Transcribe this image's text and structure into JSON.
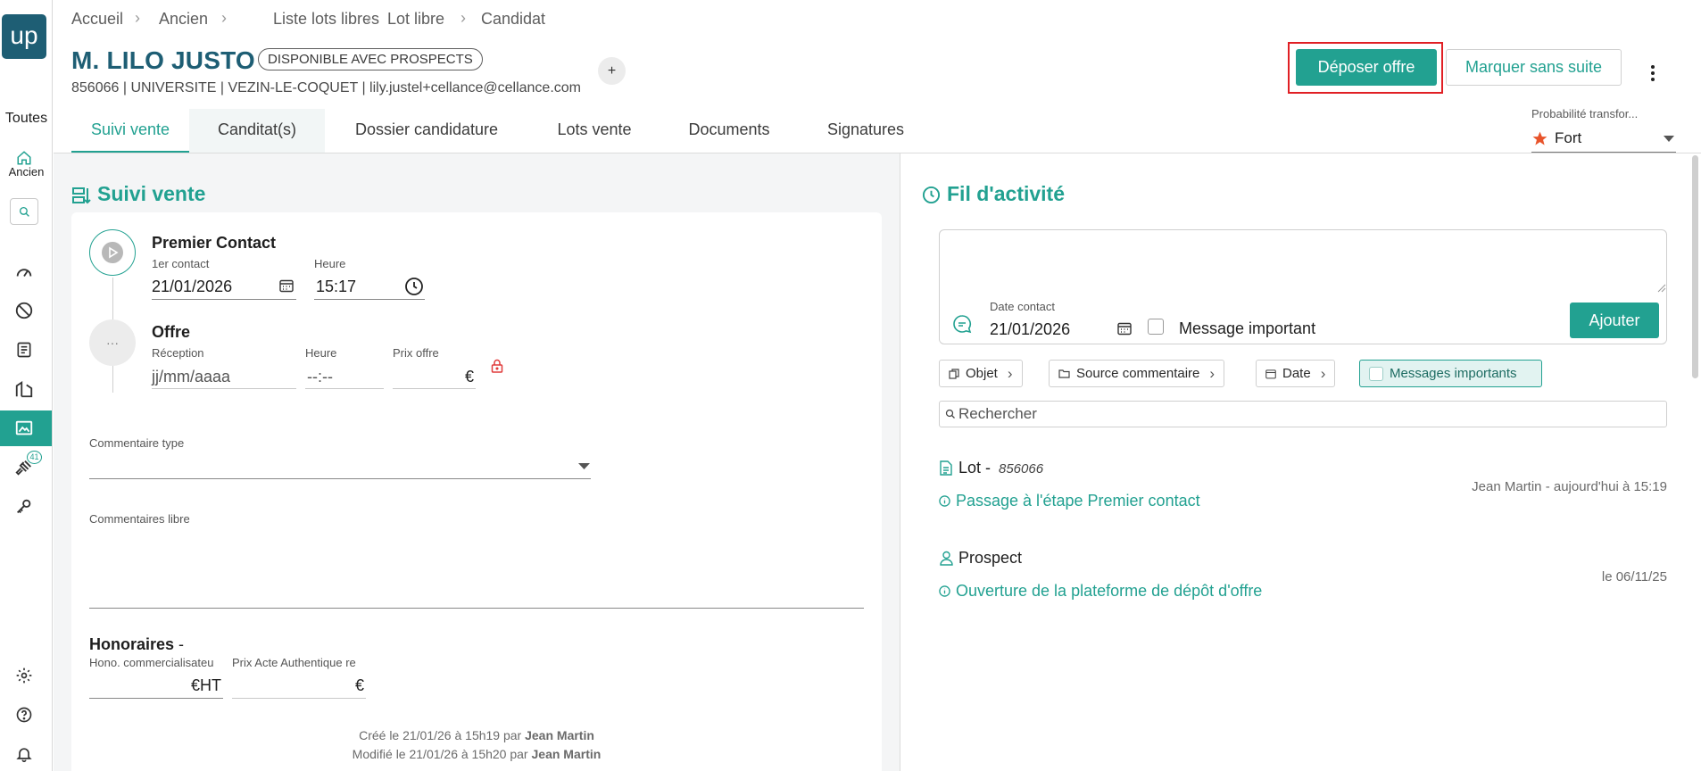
{
  "sidebar": {
    "logo": "up",
    "all_label": "Toutes",
    "home_label": "Ancien",
    "badge_count": "41"
  },
  "breadcrumb": [
    "Accueil",
    "Ancien",
    "Liste lots libres",
    "Lot libre",
    "Candidat"
  ],
  "header": {
    "name": "M. LILO JUSTO",
    "status": "DISPONIBLE AVEC PROSPECTS",
    "subline": "856066 | UNIVERSITE | VEZIN-LE-COQUET | lily.justel+cellance@cellance.com",
    "plus": "+",
    "primary_action": "Déposer offre",
    "secondary_action": "Marquer sans suite"
  },
  "tabs": [
    "Suivi vente",
    "Canditat(s)",
    "Dossier candidature",
    "Lots vente",
    "Documents",
    "Signatures"
  ],
  "probability": {
    "label": "Probabilité transfor...",
    "value": "Fort"
  },
  "suivi": {
    "title": "Suivi vente",
    "step1": {
      "title": "Premier Contact",
      "date_label": "1er contact",
      "date_value": "21/01/2026",
      "time_label": "Heure",
      "time_value": "15:17"
    },
    "step2": {
      "title": "Offre",
      "date_label": "Réception",
      "date_placeholder": "jj/mm/aaaa",
      "time_label": "Heure",
      "time_placeholder": "--:--",
      "price_label": "Prix offre",
      "currency": "€",
      "dots": "···"
    },
    "comment_type_label": "Commentaire type",
    "comment_free_label": "Commentaires libre",
    "fees": {
      "title": "Honoraires",
      "dash": "-",
      "hono_label": "Hono. commercialisateu",
      "hono_unit": "€HT",
      "price_label": "Prix Acte Authentique re",
      "price_unit": "€"
    },
    "created_prefix": "Créé le 21/01/26 à 15h19 par",
    "created_by": "Jean Martin",
    "modified_prefix": "Modifié le 21/01/26 à 15h20 par",
    "modified_by": "Jean Martin"
  },
  "activity": {
    "title": "Fil d'activité",
    "date_label": "Date contact",
    "date_value": "21/01/2026",
    "important_label": "Message important",
    "add_button": "Ajouter",
    "filters": [
      "Objet",
      "Source commentaire",
      "Date",
      "Messages importants"
    ],
    "search_placeholder": "Rechercher",
    "items": [
      {
        "title": "Lot -",
        "ref": "856066",
        "event": "Passage à l'étape Premier contact",
        "meta": "Jean Martin - aujourd'hui à 15:19"
      },
      {
        "title": "Prospect",
        "ref": "",
        "event": "Ouverture de la plateforme de dépôt d'offre",
        "meta": "le 06/11/25"
      }
    ]
  },
  "colors": {
    "accent": "#22a191",
    "brand": "#1e5e74",
    "highlight": "#e01f24",
    "star": "#e8542b"
  }
}
